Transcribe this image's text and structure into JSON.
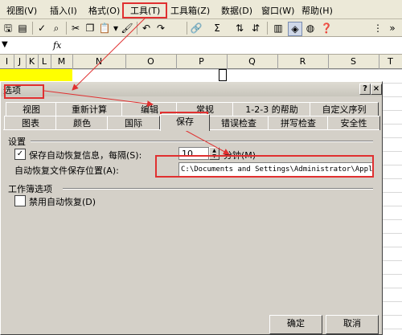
{
  "menu": {
    "view": "视图(V)",
    "insert": "插入(I)",
    "format": "格式(O)",
    "tools": "工具(T)",
    "toolbox": "工具箱(Z)",
    "data": "数据(D)",
    "window": "窗口(W)",
    "help": "帮助(H)"
  },
  "toolbar": {
    "sigma": "Σ"
  },
  "formula_bar": {
    "fx": "fx"
  },
  "columns": [
    "I",
    "J",
    "K",
    "L",
    "M",
    "N",
    "O",
    "P",
    "Q",
    "R",
    "S",
    "T"
  ],
  "dialog": {
    "title": "选项",
    "help": "?",
    "close": "×",
    "tabs_row1": [
      "视图",
      "重新计算",
      "编辑",
      "常规",
      "1-2-3 的帮助",
      "自定义序列"
    ],
    "tabs_row2": [
      "图表",
      "颜色",
      "国际",
      "保存",
      "错误检查",
      "拼写检查",
      "安全性"
    ],
    "active_tab": "保存",
    "settings_label": "设置",
    "autorecover_checkbox_label": "保存自动恢复信息，每隔(S):",
    "autorecover_checked": true,
    "autorecover_minutes": "10",
    "minutes_label": "分钟(M)",
    "autorecover_path_label": "自动恢复文件保存位置(A):",
    "autorecover_path": "C:\\Documents and Settings\\Administrator\\Applic",
    "workbook_options_label": "工作簿选项",
    "disable_autorecover_label": "禁用自动恢复(D)",
    "disable_autorecover_checked": false,
    "ok_button": "确定",
    "cancel_button": "取消"
  },
  "colors": {
    "annotation": "#e03030",
    "highlight": "#ffff00"
  }
}
